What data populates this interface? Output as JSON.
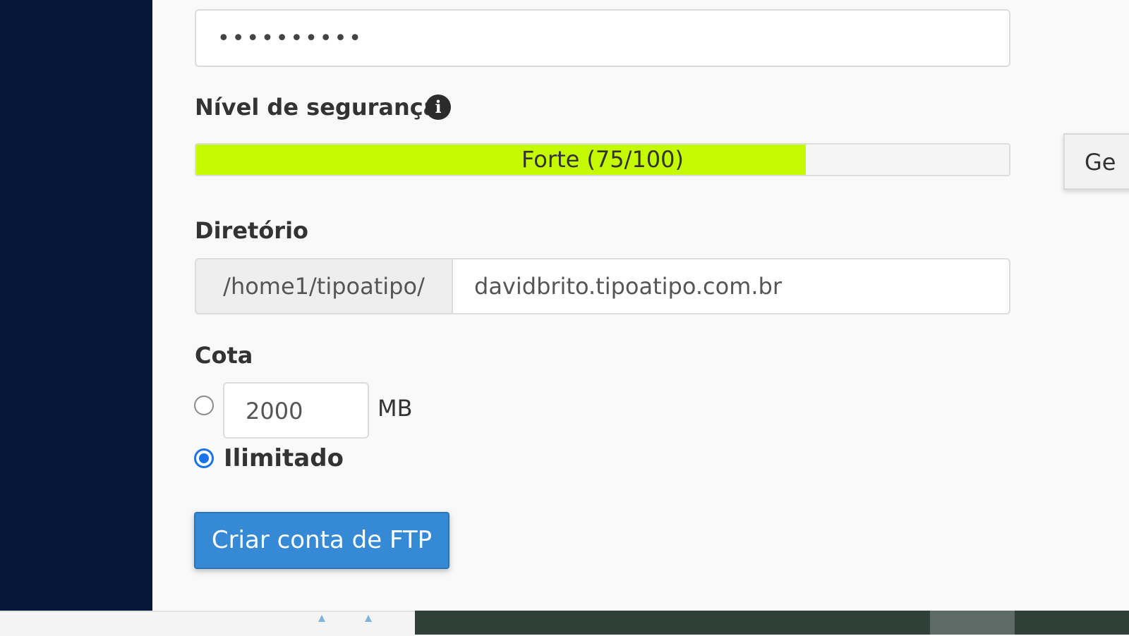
{
  "password": {
    "masked_value": "••••••••••"
  },
  "security": {
    "label": "Nível de segurança",
    "info_icon": "info-icon",
    "strength_text": "Forte (75/100)",
    "strength_value": 75,
    "strength_max": 100,
    "fill_color": "#c4fb00"
  },
  "generate_button": {
    "label": "Ge"
  },
  "directory": {
    "label": "Diretório",
    "prefix": "/home1/tipoatipo/",
    "value": "davidbrito.tipoatipo.com.br"
  },
  "quota": {
    "label": "Cota",
    "value": "2000",
    "unit": "MB",
    "unlimited_label": "Ilimitado",
    "selected": "unlimited"
  },
  "create_button": {
    "label": "Criar conta de FTP",
    "color": "#3589d5"
  },
  "colors": {
    "sidebar": "#06183a",
    "radio_accent": "#1a73e8"
  }
}
